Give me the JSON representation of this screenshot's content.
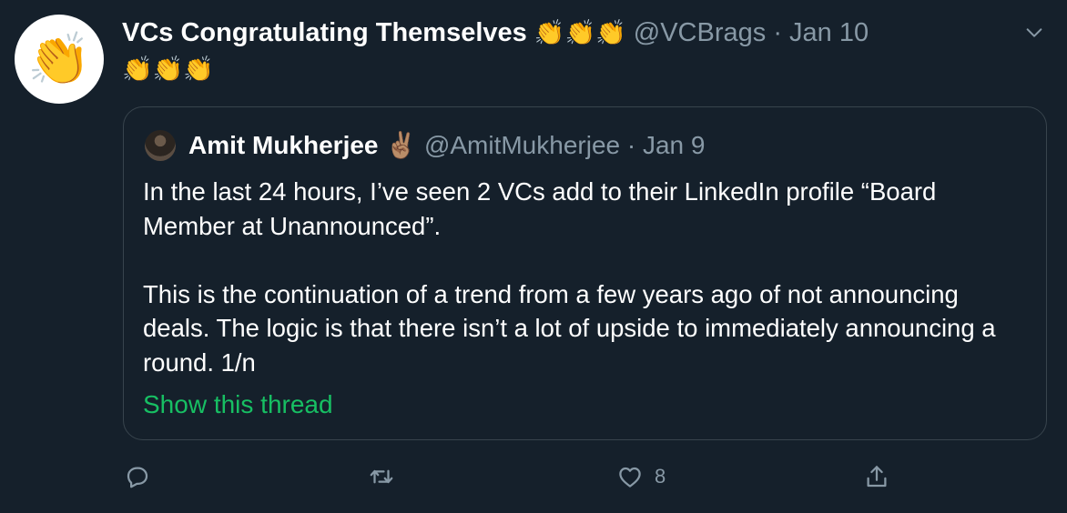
{
  "tweet": {
    "avatar_icon": "clapping-hands-icon",
    "display_name": "VCs Congratulating Themselves",
    "name_emoji": "👏👏👏",
    "handle": "@VCBrags",
    "separator": "·",
    "date": "Jan 10",
    "emoji_line": "👏👏👏",
    "caret_icon": "chevron-down-icon"
  },
  "quoted": {
    "display_name": "Amit Mukherjee",
    "name_emoji": "✌🏽",
    "handle": "@AmitMukherjee",
    "separator": "·",
    "date": "Jan 9",
    "paragraph1": "In the last 24 hours, I’ve seen 2 VCs add to their LinkedIn profile “Board Member at Unannounced”.",
    "paragraph2": "This is the continuation of a trend from a few years ago of not announcing deals. The logic is that there isn’t a lot of upside to immediately announcing a round. 1/n",
    "show_thread": "Show this thread"
  },
  "actions": {
    "reply_icon": "reply-icon",
    "retweet_icon": "retweet-icon",
    "like_icon": "heart-icon",
    "like_count": "8",
    "share_icon": "share-icon"
  },
  "colors": {
    "background": "#15202b",
    "muted": "#8899a6",
    "border": "#38444d",
    "link_green": "#17bf63"
  }
}
